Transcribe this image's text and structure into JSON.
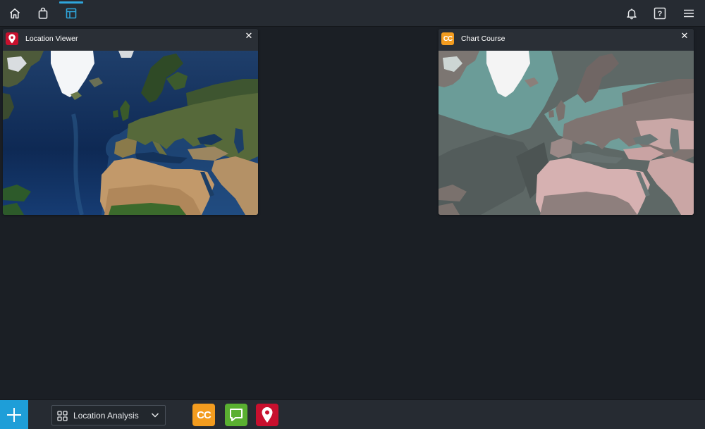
{
  "topbar": {
    "left_icons": [
      "home-icon",
      "shopping-bag-icon",
      "layout-icon"
    ],
    "active_icon": "layout-icon",
    "right_icons": [
      "bell-icon",
      "help-icon",
      "menu-icon"
    ],
    "help_glyph": "?",
    "accent_color": "#2fa6dc"
  },
  "panels": [
    {
      "title": "Location Viewer",
      "icon": "map-pin-icon",
      "icon_color": "#c8102e",
      "close_label": "✕",
      "map_style": "satellite"
    },
    {
      "title": "Chart Course",
      "icon": "cc-icon",
      "icon_text": "CC",
      "icon_color": "#f39c1f",
      "close_label": "✕",
      "map_style": "muted"
    }
  ],
  "bottombar": {
    "add_label": "+",
    "workspace_label": "Location Analysis",
    "dock_apps": [
      {
        "icon": "cc-icon",
        "text": "CC",
        "color": "#f39c1f"
      },
      {
        "icon": "chat-icon",
        "color": "#5ab031"
      },
      {
        "icon": "map-pin-icon",
        "color": "#c8102e"
      }
    ]
  }
}
